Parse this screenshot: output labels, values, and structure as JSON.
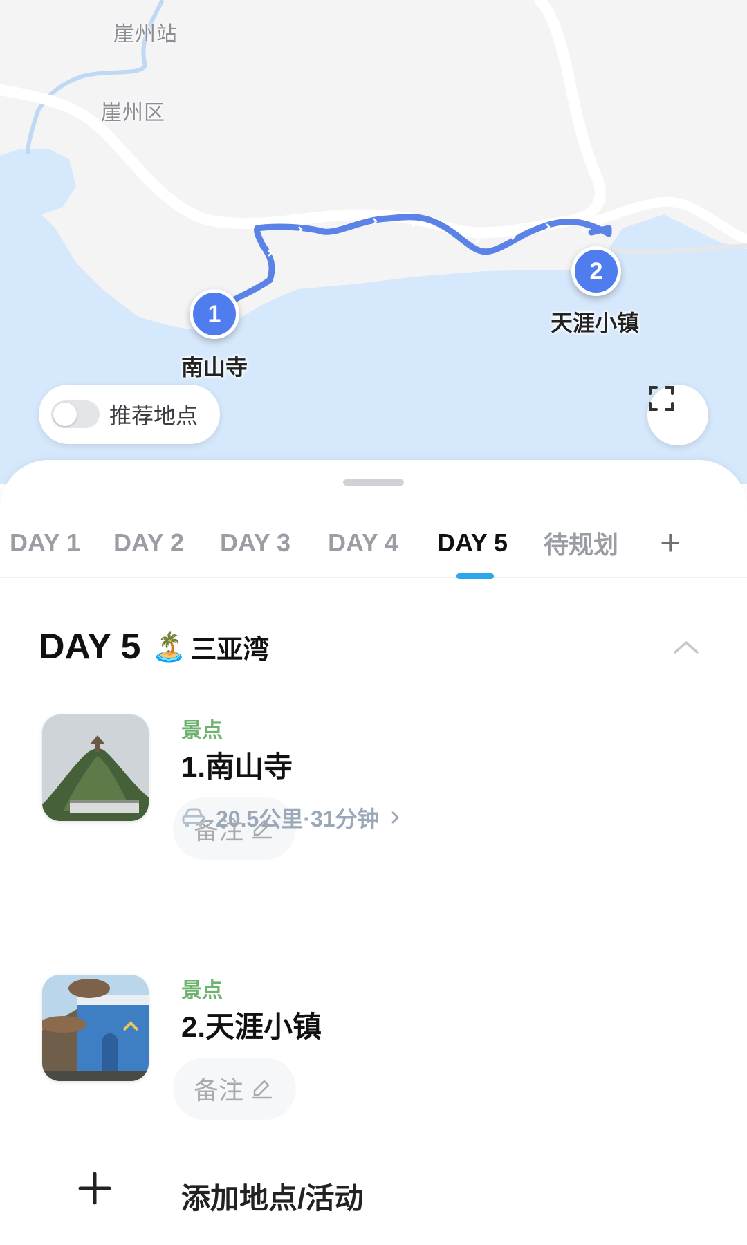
{
  "map": {
    "labels": {
      "station": "崖州站",
      "district": "崖州区"
    },
    "stops": [
      {
        "index": "1",
        "label": "南山寺"
      },
      {
        "index": "2",
        "label": "天涯小镇"
      }
    ],
    "recommend_toggle": {
      "label": "推荐地点",
      "on": false
    },
    "fullscreen_icon": "fullscreen-icon"
  },
  "tabs": [
    {
      "label": "DAY 1",
      "active": false
    },
    {
      "label": "DAY 2",
      "active": false
    },
    {
      "label": "DAY 3",
      "active": false
    },
    {
      "label": "DAY 4",
      "active": false
    },
    {
      "label": "DAY 5",
      "active": true
    },
    {
      "label": "待规划",
      "active": false
    },
    {
      "label": "+",
      "active": false
    }
  ],
  "day": {
    "title": "DAY 5",
    "emoji": "🏝️",
    "place": "三亚湾",
    "stops": [
      {
        "category": "景点",
        "name": "1.南山寺",
        "note": "备注"
      },
      {
        "category": "景点",
        "name": "2.天涯小镇",
        "note": "备注"
      }
    ],
    "route": {
      "text": "20.5公里·31分钟",
      "icon": "car-icon"
    }
  },
  "add_action": {
    "label": "添加地点/活动"
  },
  "colors": {
    "accent": "#2ca7e8",
    "pin": "#4f7df0",
    "route_line": "#5b82e6",
    "sea": "#d6e8fb",
    "land": "#f4f4f4",
    "category": "#6db36e"
  }
}
